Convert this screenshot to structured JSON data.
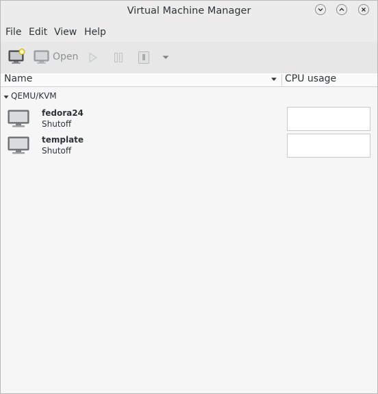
{
  "window": {
    "title": "Virtual Machine Manager"
  },
  "menubar": {
    "items": [
      {
        "label": "File"
      },
      {
        "label": "Edit"
      },
      {
        "label": "View"
      },
      {
        "label": "Help"
      }
    ]
  },
  "toolbar": {
    "open_label": "Open"
  },
  "columns": {
    "name": "Name",
    "cpu": "CPU usage"
  },
  "connections": [
    {
      "name": "QEMU/KVM",
      "vms": [
        {
          "name": "fedora24",
          "status": "Shutoff"
        },
        {
          "name": "template",
          "status": "Shutoff"
        }
      ]
    }
  ]
}
